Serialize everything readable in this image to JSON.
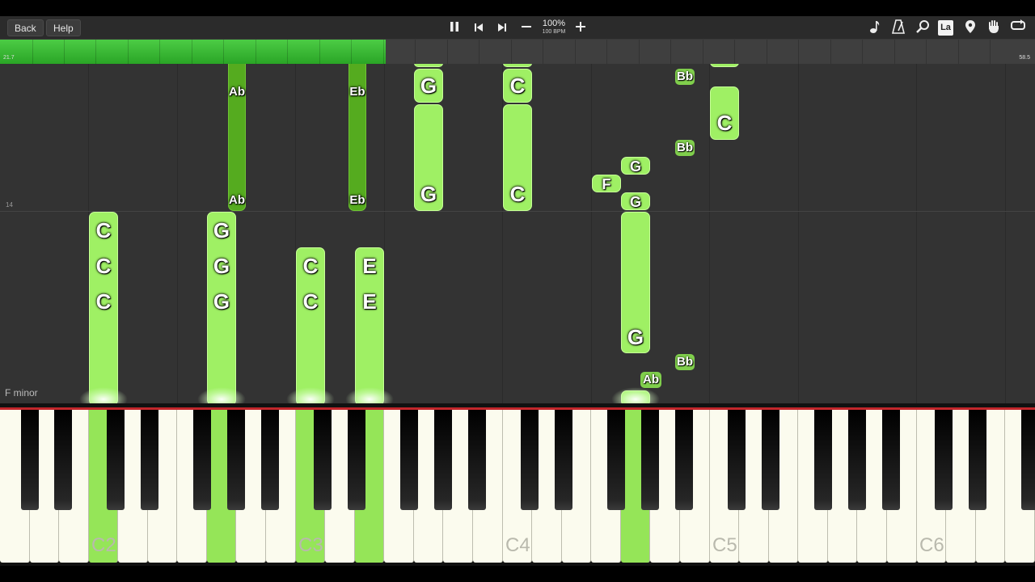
{
  "toolbar": {
    "back_label": "Back",
    "help_label": "Help",
    "speed_percent": "100%",
    "speed_bpm": "100 BPM",
    "icons": [
      "pause-icon",
      "skip-back-icon",
      "skip-forward-icon",
      "minus-icon",
      "plus-icon",
      "note-icon",
      "metronome-icon",
      "magnifier-icon",
      "la-icon",
      "location-pin-icon",
      "hand-icon",
      "loop-icon"
    ],
    "la_label": "La"
  },
  "progress": {
    "current": "21.7",
    "total": "58.5",
    "fraction": 0.373,
    "color": "#3abb33"
  },
  "roll": {
    "measure_number": "14",
    "key_signature": "F minor"
  },
  "notes": {
    "c2a": "C",
    "c2b": "C",
    "c2c": "C",
    "g2a": "G",
    "g2b": "G",
    "g2c": "G",
    "c3a": "C",
    "c3b": "C",
    "e3a": "E",
    "e3b": "E",
    "ab_top": "Ab",
    "ab_bot": "Ab",
    "eb_top": "Eb",
    "eb_bot": "Eb",
    "g4_top": "G",
    "g4_bot": "G",
    "c4_top": "C",
    "c4_bot": "C",
    "f_note": "F",
    "g_small1": "G",
    "g_small2": "G",
    "g_long": "G",
    "ab_low": "Ab",
    "bb1": "Bb",
    "bb2": "Bb",
    "bb3": "Bb",
    "c5": "C"
  },
  "keyboard": {
    "labels": [
      "C2",
      "C3",
      "C4",
      "C5",
      "C6"
    ],
    "active_color": "#95e558"
  }
}
